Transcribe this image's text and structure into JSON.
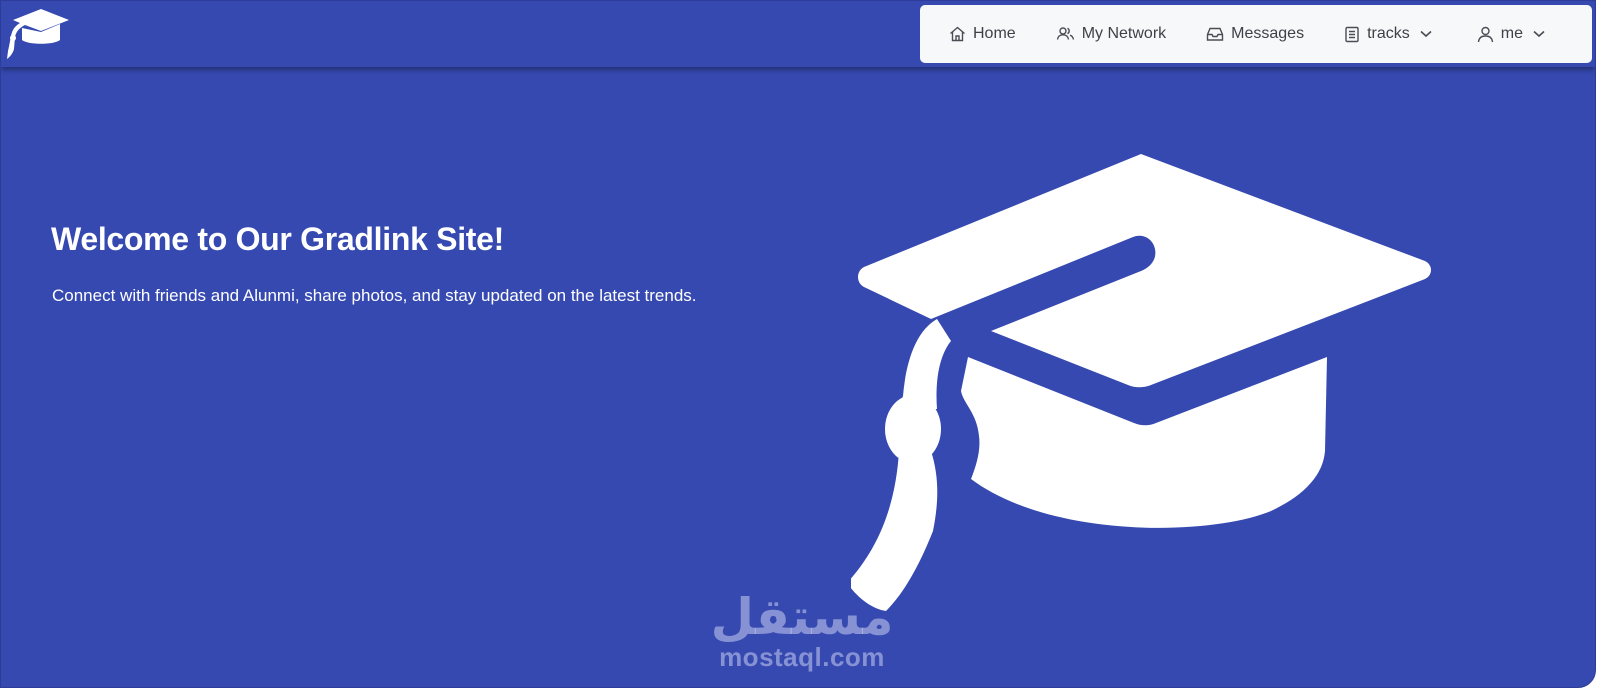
{
  "brand": {
    "icon": "graduation-cap-icon",
    "color": "#3649b1"
  },
  "nav": {
    "items": [
      {
        "label": "Home",
        "icon": "home-icon"
      },
      {
        "label": "My Network",
        "icon": "people-icon"
      },
      {
        "label": "Messages",
        "icon": "inbox-icon"
      },
      {
        "label": "tracks",
        "icon": "document-icon",
        "dropdown": true
      },
      {
        "label": "me",
        "icon": "user-icon",
        "dropdown": true
      }
    ]
  },
  "hero": {
    "title": "Welcome to Our Gradlink Site!",
    "subtitle": "Connect with friends and Alunmi, share photos, and stay updated on the latest trends.",
    "illustration": "graduation-cap-icon"
  },
  "watermark": {
    "arabic": "مستقل",
    "latin": "mostaql.com"
  },
  "colors": {
    "background": "#3649b1",
    "nav_background": "#f7f8fa",
    "nav_text": "#3e4147",
    "hero_text": "#ffffff"
  }
}
